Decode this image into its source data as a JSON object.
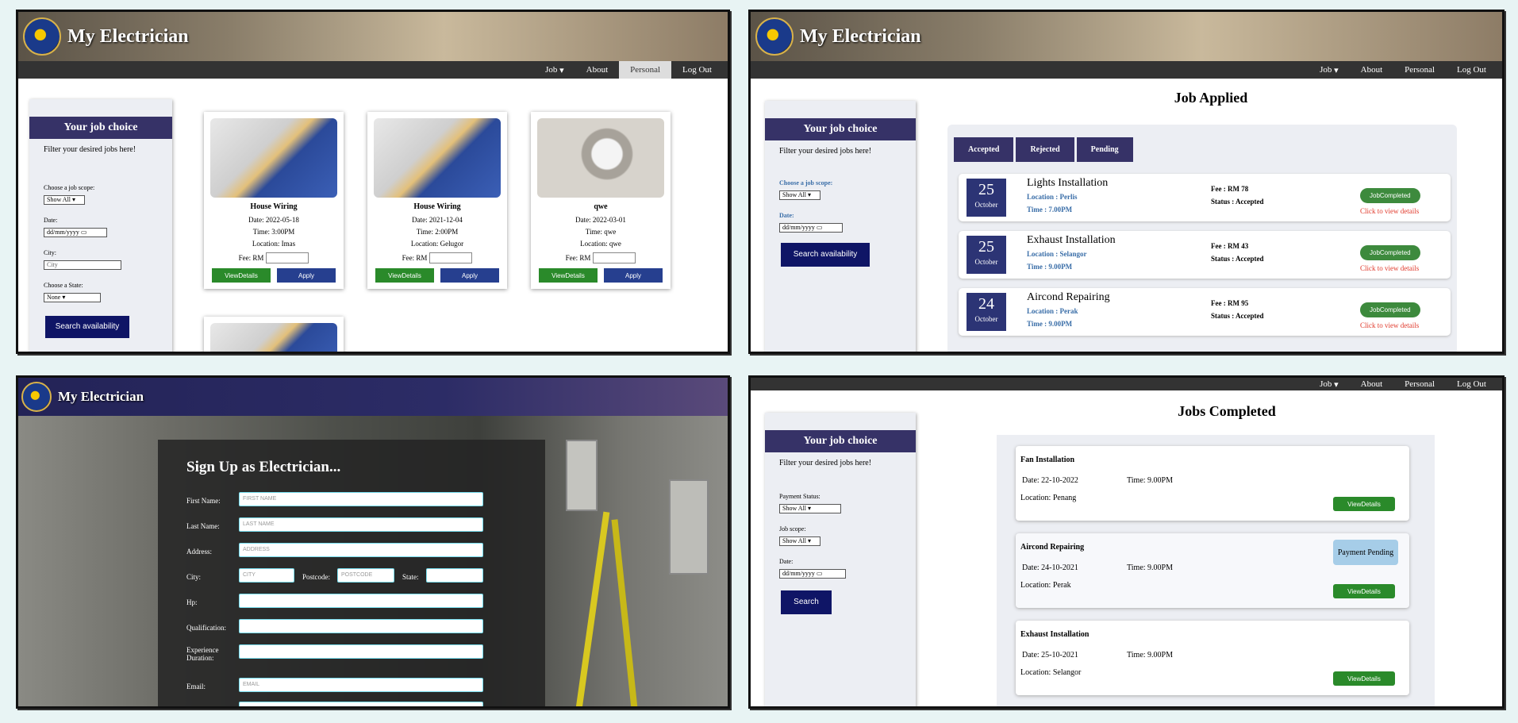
{
  "app": {
    "brand": "My Electrician"
  },
  "nav": {
    "job": "Job",
    "about": "About",
    "personal": "Personal",
    "logout": "Log Out"
  },
  "sidebar1": {
    "heading": "Your job choice",
    "subtitle": "Filter your desired jobs here!",
    "scope_label": "Choose a job scope:",
    "scope_value": "Show All",
    "date_label": "Date:",
    "date_placeholder": "dd/mm/yyyy",
    "city_label": "City:",
    "city_placeholder": "City",
    "state_label": "Choose a State:",
    "state_value": "None",
    "search": "Search availability"
  },
  "cards": [
    {
      "title": "House Wiring",
      "date": "Date: 2022-05-18",
      "time": "Time: 3:00PM",
      "location": "Location: Imas",
      "fee": "Fee: RM",
      "details": "ViewDetails",
      "apply": "Apply"
    },
    {
      "title": "House Wiring",
      "date": "Date: 2021-12-04",
      "time": "Time: 2:00PM",
      "location": "Location: Gelugor",
      "fee": "Fee: RM",
      "details": "ViewDetails",
      "apply": "Apply"
    },
    {
      "title": "qwe",
      "date": "Date: 2022-03-01",
      "time": "Time: qwe",
      "location": "Location: qwe",
      "fee": "Fee: RM",
      "details": "ViewDetails",
      "apply": "Apply"
    }
  ],
  "applied": {
    "title": "Job Applied",
    "tabs": [
      "Accepted",
      "Rejected",
      "Pending"
    ],
    "sidebar": {
      "heading": "Your job choice",
      "subtitle": "Filter your desired jobs here!",
      "scope_label": "Choose a job scope:",
      "scope_value": "Show All",
      "date_label": "Date:",
      "date_placeholder": "dd/mm/yyyy",
      "search": "Search availability"
    },
    "jobs": [
      {
        "day": "25",
        "month": "October",
        "name": "Lights Installation",
        "location": "Location : Perlis",
        "time": "Time : 7.00PM",
        "fee": "Fee : RM 78",
        "status": "Status : Accepted",
        "button": "JobCompleted",
        "link": "Click to view details"
      },
      {
        "day": "25",
        "month": "October",
        "name": "Exhaust Installation",
        "location": "Location : Selangor",
        "time": "Time : 9.00PM",
        "fee": "Fee : RM 43",
        "status": "Status : Accepted",
        "button": "JobCompleted",
        "link": "Click to view details"
      },
      {
        "day": "24",
        "month": "October",
        "name": "Aircond Repairing",
        "location": "Location : Perak",
        "time": "Time : 9.00PM",
        "fee": "Fee : RM 95",
        "status": "Status : Accepted",
        "button": "JobCompleted",
        "link": "Click to view details"
      }
    ]
  },
  "signup": {
    "title": "Sign Up as Electrician...",
    "first_name": "First Name:",
    "first_ph": "FIRST NAME",
    "last_name": "Last Name:",
    "last_ph": "LAST NAME",
    "address": "Address:",
    "address_ph": "ADDRESS",
    "city": "City:",
    "city_ph": "CITY",
    "postcode": "Postcode:",
    "postcode_ph": "POSTCODE",
    "state": "State:",
    "hp": "Hp:",
    "qualification": "Qualification:",
    "experience": "Experience Duration:",
    "email": "Email:",
    "email_ph": "EMAIL"
  },
  "completed": {
    "title": "Jobs Completed",
    "sidebar": {
      "heading": "Your job choice",
      "subtitle": "Filter your desired jobs here!",
      "payment_label": "Payment Status:",
      "payment_value": "Show All",
      "scope_label": "Job scope:",
      "scope_value": "Show All",
      "date_label": "Date:",
      "date_placeholder": "dd/mm/yyyy",
      "search": "Search"
    },
    "jobs": [
      {
        "name": "Fan Installation",
        "date": "Date: 22-10-2022",
        "time": "Time: 9.00PM",
        "location": "Location: Penang",
        "button": "ViewDetails",
        "pending": ""
      },
      {
        "name": "Aircond Repairing",
        "date": "Date: 24-10-2021",
        "time": "Time: 9.00PM",
        "location": "Location: Perak",
        "button": "ViewDetails",
        "pending": "Payment Pending"
      },
      {
        "name": "Exhaust Installation",
        "date": "Date: 25-10-2021",
        "time": "Time: 9.00PM",
        "location": "Location: Selangor",
        "button": "ViewDetails",
        "pending": ""
      }
    ]
  }
}
